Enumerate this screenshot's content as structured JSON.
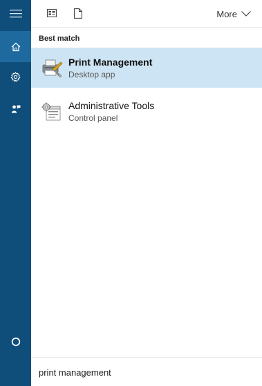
{
  "toolbar": {
    "more_label": "More"
  },
  "results": {
    "section_label": "Best match",
    "items": [
      {
        "title": "Print Management",
        "subtitle": "Desktop app",
        "icon": "print-management-icon"
      },
      {
        "title": "Administrative Tools",
        "subtitle": "Control panel",
        "icon": "administrative-tools-icon"
      }
    ]
  },
  "search": {
    "query": "print management"
  },
  "colors": {
    "sidebar": "#0f4d7a",
    "sidebar_active": "#1e6a9f",
    "selected_row": "#cde4f4"
  }
}
